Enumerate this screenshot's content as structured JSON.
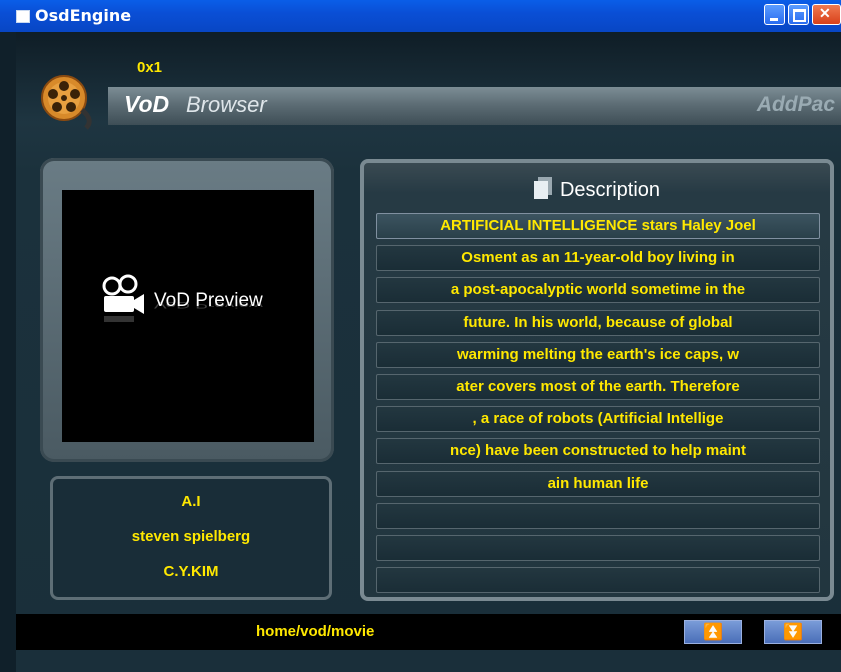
{
  "window": {
    "title": "OsdEngine"
  },
  "header": {
    "counter": "0x1",
    "app_name_bold": "VoD",
    "app_name_rest": "Browser",
    "brand": "AddPac"
  },
  "preview": {
    "label": "VoD Preview"
  },
  "info": {
    "title": "A.I",
    "director": "steven spielberg",
    "author": "C.Y.KIM"
  },
  "description": {
    "header": "Description",
    "lines": [
      "ARTIFICIAL INTELLIGENCE stars Haley Joel",
      "Osment as an 11-year-old boy living in",
      "a post-apocalyptic world sometime in the",
      "future. In his world, because of global",
      "warming melting the earth's ice caps, w",
      "ater covers most of the earth. Therefore",
      ", a race of robots (Artificial Intellige",
      "nce) have been constructed to help maint",
      "ain human life",
      "",
      "",
      ""
    ]
  },
  "footer": {
    "path": "home/vod/movie",
    "up_icon": "double-chevron-up-icon",
    "down_icon": "double-chevron-down-icon",
    "up_glyph": "⏫",
    "down_glyph": "⏬"
  },
  "colors": {
    "accent_text": "#ffe800",
    "titlebar": "#0a4fd6",
    "panel": "#1a2f3a"
  }
}
